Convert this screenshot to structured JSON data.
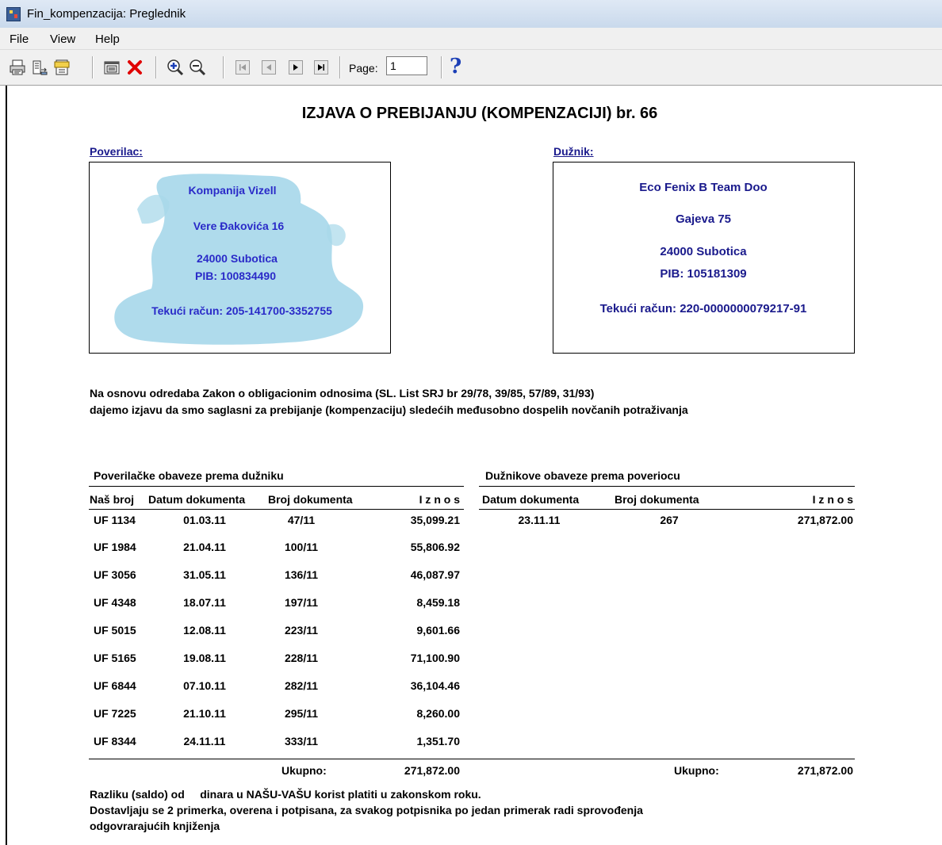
{
  "window": {
    "title": "Fin_kompenzacija: Preglednik"
  },
  "menu": {
    "items": [
      "File",
      "View",
      "Help"
    ]
  },
  "toolbar": {
    "page_label": "Page:",
    "page_value": "1",
    "help_label": "?"
  },
  "document": {
    "title": "IZJAVA O PREBIJANJU (KOMPENZACIJI) br. 66",
    "creditor": {
      "label": "Poverilac:",
      "stamp_lines": [
        "Kompanija Vizell",
        "Vere Đakovića 16",
        "24000 Subotica",
        "PIB: 100834490",
        "Tekući račun: 205-141700-3352755"
      ]
    },
    "debtor": {
      "label": "Dužnik:",
      "name": "Eco Fenix B Team  Doo",
      "street": "Gajeva 75",
      "city": "24000 Subotica",
      "pib": "PIB:  105181309",
      "account": "Tekući račun:  220-0000000079217-91"
    },
    "intro_line1": "Na osnovu odredaba Zakon o obligacionim odnosima (SL. List SRJ br 29/78, 39/85, 57/89, 31/93)",
    "intro_line2": "dajemo izjavu da smo saglasni za prebijanje (kompenzaciju) sledećih međusobno dospelih novčanih potraživanja",
    "left_table": {
      "title": "Poverilačke obaveze prema dužniku",
      "headers": [
        "Naš broj",
        "Datum dokumenta",
        "Broj dokumenta",
        "I z n o s"
      ],
      "rows": [
        [
          "UF 1134",
          "01.03.11",
          "47/11",
          "35,099.21"
        ],
        [
          "UF 1984",
          "21.04.11",
          "100/11",
          "55,806.92"
        ],
        [
          "UF 3056",
          "31.05.11",
          "136/11",
          "46,087.97"
        ],
        [
          "UF 4348",
          "18.07.11",
          "197/11",
          "8,459.18"
        ],
        [
          "UF 5015",
          "12.08.11",
          "223/11",
          "9,601.66"
        ],
        [
          "UF 5165",
          "19.08.11",
          "228/11",
          "71,100.90"
        ],
        [
          "UF 6844",
          "07.10.11",
          "282/11",
          "36,104.46"
        ],
        [
          "UF 7225",
          "21.10.11",
          "295/11",
          "8,260.00"
        ],
        [
          "UF 8344",
          "24.11.11",
          "333/11",
          "1,351.70"
        ]
      ],
      "total_label": "Ukupno:",
      "total": "271,872.00"
    },
    "right_table": {
      "title": "Dužnikove obaveze prema poveriocu",
      "headers": [
        "Datum dokumenta",
        "Broj dokumenta",
        "I z n o s"
      ],
      "rows": [
        [
          "23.11.11",
          "267",
          "271,872.00"
        ]
      ],
      "total_label": "Ukupno:",
      "total": "271,872.00"
    },
    "footer_line1": "Razliku (saldo) od     dinara u NAŠU-VAŠU korist platiti u zakonskom roku.",
    "footer_line2": "Dostavljaju se 2 primerka, overena i potpisana, za svakog potpisnika po jedan primerak radi sprovođenja",
    "footer_line3": "odgovrarajućih knjiženja"
  },
  "colors": {
    "stamp": "#a8d8ea",
    "stamp_text": "#2a2ac8",
    "debtor_text": "#1a1a8c",
    "help": "#1b3fb6",
    "delete": "#e00000"
  }
}
